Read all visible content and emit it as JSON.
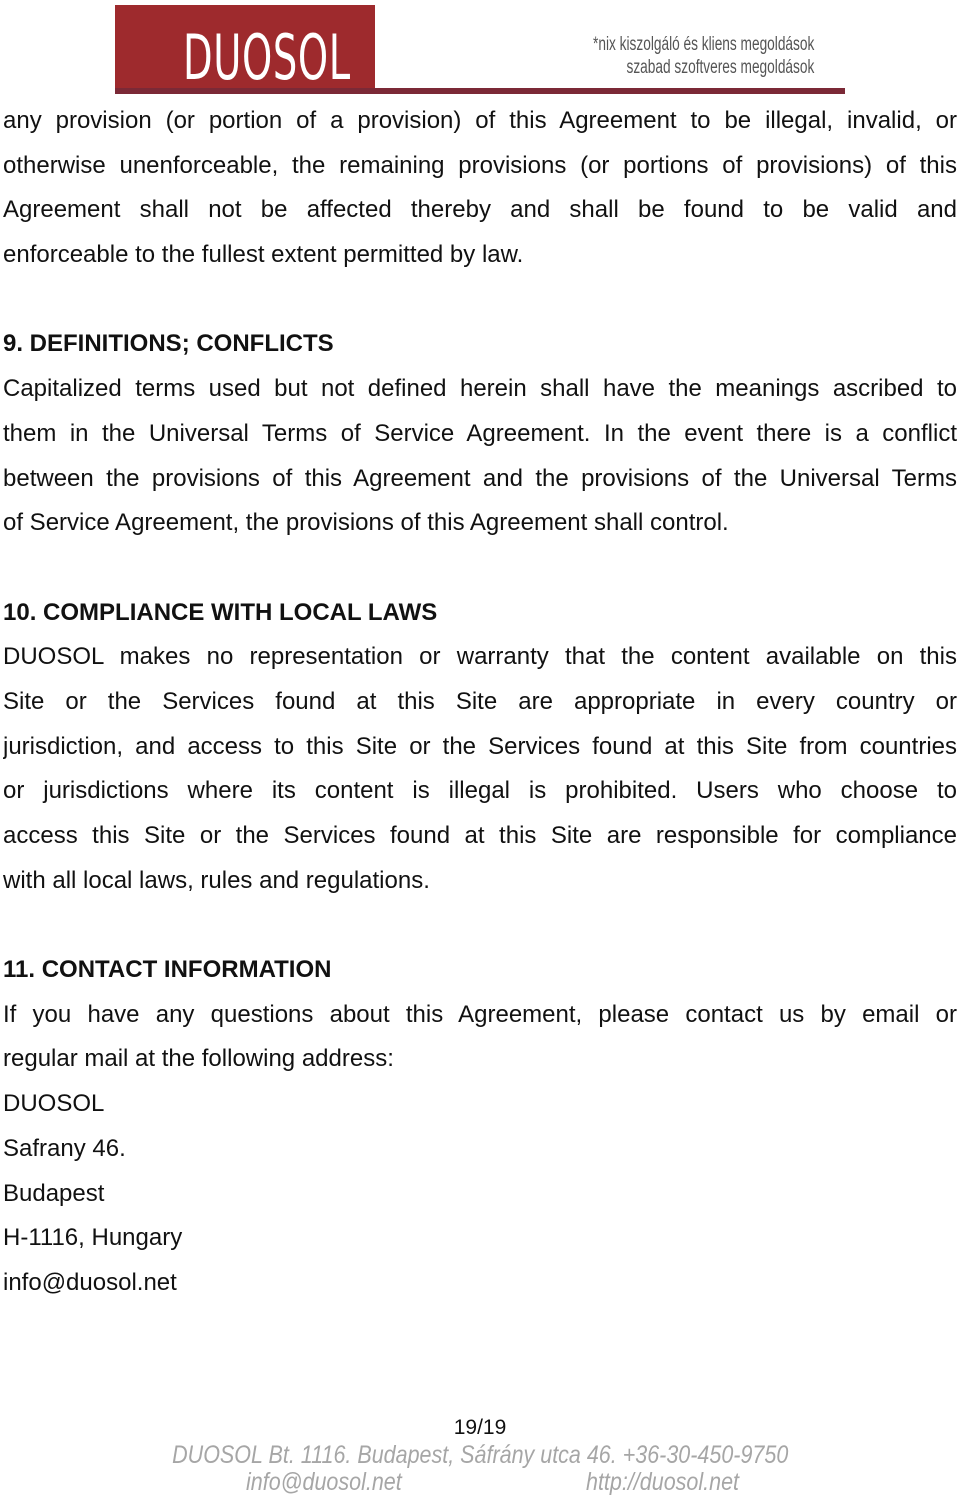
{
  "header": {
    "logo_text": "DUOSOL",
    "tagline_line1": "*nix kiszolgáló és kliens megoldások",
    "tagline_line2": "szabad szoftveres megoldások",
    "brand_color": "#9e2a2d",
    "rule_color": "#7b2936"
  },
  "document": {
    "intro_paragraph": [
      "any provision (or portion of a provision) of this Agreement to be illegal, invalid, or",
      "otherwise unenforceable, the remaining provisions (or portions of provisions) of this",
      "Agreement shall not be affected thereby and shall be found to be valid and",
      "enforceable to the fullest extent permitted by law."
    ],
    "sections": [
      {
        "heading": "9. DEFINITIONS; CONFLICTS",
        "lines": [
          "Capitalized terms used but not defined herein shall have the meanings ascribed to",
          "them in the Universal Terms of Service Agreement. In the event there is a conflict",
          "between the provisions of this Agreement and the provisions of the Universal Terms",
          "of Service Agreement, the provisions of this Agreement shall control."
        ]
      },
      {
        "heading": "10. COMPLIANCE WITH LOCAL LAWS",
        "lines": [
          "DUOSOL makes no representation or warranty that the content available on this",
          "Site or the Services found at this Site are appropriate in every country or",
          "jurisdiction, and access to this Site or the Services found at this Site from countries",
          "or jurisdictions where its content is illegal is prohibited.  Users who choose to",
          "access this Site or the Services found at this Site are responsible for compliance",
          "with all local laws, rules and regulations."
        ]
      },
      {
        "heading": "11. CONTACT INFORMATION",
        "lines": [
          "If you have any questions about this Agreement, please contact us by email or",
          "regular mail at the following address:"
        ],
        "address": [
          "DUOSOL",
          "Safrany 46.",
          "Budapest",
          "H-1116, Hungary",
          "info@duosol.net"
        ]
      }
    ]
  },
  "footer": {
    "page_number": "19/19",
    "address_line": "DUOSOL Bt. 1116. Budapest, Sáfrány utca 46. +36-30-450-9750",
    "email_link": "info@duosol.net",
    "website_link": "http://duosol.net"
  }
}
